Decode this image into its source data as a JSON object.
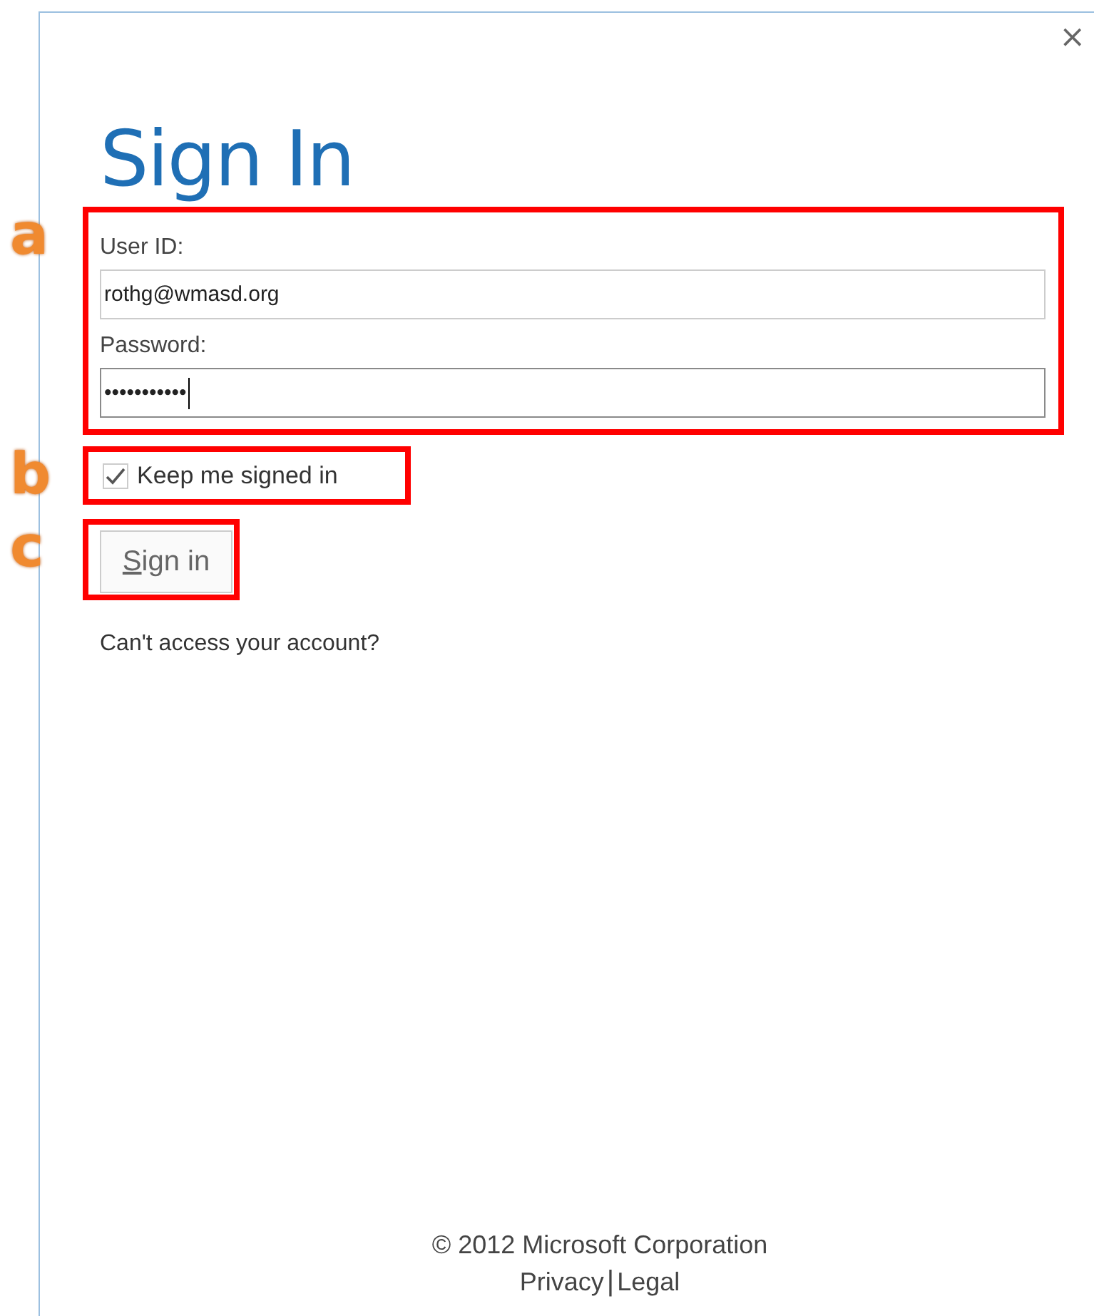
{
  "window": {
    "title": "Sign In",
    "close": "×"
  },
  "annotations": [
    {
      "label": "a"
    },
    {
      "label": "b"
    },
    {
      "label": "c"
    }
  ],
  "fields": [
    {
      "label": "User ID:",
      "value": "rothg@wmasd.org",
      "focused": false
    },
    {
      "label": "Password:",
      "value": "•••••••••••",
      "focused": true
    }
  ],
  "keep_signed_in": {
    "label": "Keep me signed in",
    "checked": true
  },
  "sign_in_button": {
    "access_key": "S",
    "label_rest": "ign in"
  },
  "help_link": "Can't access your account?",
  "footer": {
    "copyright": "© 2012 Microsoft Corporation",
    "links": [
      "Privacy",
      "Legal"
    ],
    "separator": "|"
  }
}
